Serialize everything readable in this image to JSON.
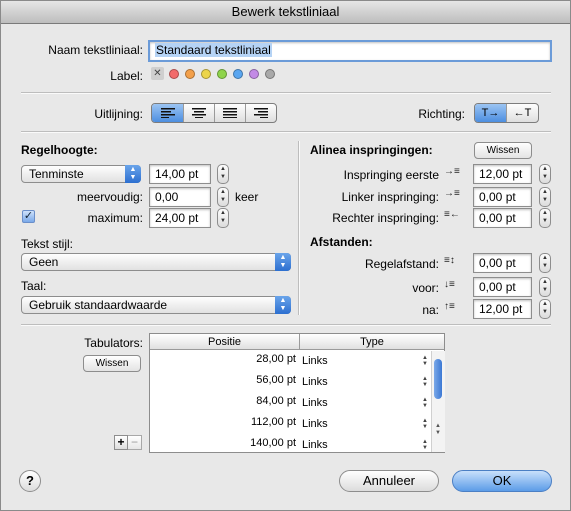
{
  "window": {
    "title": "Bewerk tekstliniaal"
  },
  "name_field": {
    "label": "Naam tekstliniaal:",
    "value": "Standaard tekstliniaal"
  },
  "label_row": {
    "label": "Label:",
    "none_glyph": "✕",
    "colors": [
      "#f26b6b",
      "#f3a04a",
      "#ecd54a",
      "#8fd44b",
      "#5aa6f0",
      "#c38ae6",
      "#a9a9a9"
    ]
  },
  "alignment": {
    "label": "Uitlijning:",
    "selected": 0,
    "options": [
      "align-left",
      "align-center",
      "align-justify",
      "align-right"
    ]
  },
  "direction": {
    "label": "Richting:",
    "selected": 0,
    "left_to_right": "T→",
    "right_to_left": "←T"
  },
  "line_height": {
    "section": "Regelhoogte:",
    "mode": "Tenminste",
    "value": "14,00 pt",
    "multiple_label": "meervoudig:",
    "multiple_value": "0,00",
    "multiple_unit": "keer",
    "maximum_label": "maximum:",
    "maximum_value": "24,00 pt",
    "maximum_checked": true
  },
  "text_style": {
    "label": "Tekst stijl:",
    "value": "Geen"
  },
  "language": {
    "label": "Taal:",
    "value": "Gebruik standaardwaarde"
  },
  "indents": {
    "section": "Alinea inspringingen:",
    "clear_label": "Wissen",
    "first_label": "Inspringing eerste",
    "first_value": "12,00 pt",
    "left_label": "Linker inspringing:",
    "left_value": "0,00 pt",
    "right_label": "Rechter inspringing:",
    "right_value": "0,00 pt"
  },
  "spacing": {
    "section": "Afstanden:",
    "line_label": "Regelafstand:",
    "line_value": "0,00 pt",
    "before_label": "voor:",
    "before_value": "0,00 pt",
    "after_label": "na:",
    "after_value": "12,00 pt"
  },
  "tabs": {
    "label": "Tabulators:",
    "clear_label": "Wissen",
    "columns": [
      "Positie",
      "Type"
    ],
    "rows": [
      {
        "position": "28,00 pt",
        "type": "Links"
      },
      {
        "position": "56,00 pt",
        "type": "Links"
      },
      {
        "position": "84,00 pt",
        "type": "Links"
      },
      {
        "position": "112,00 pt",
        "type": "Links"
      },
      {
        "position": "140,00 pt",
        "type": "Links"
      }
    ],
    "add_label": "+",
    "remove_label": "−"
  },
  "footer": {
    "help": "?",
    "cancel": "Annuleer",
    "ok": "OK"
  }
}
